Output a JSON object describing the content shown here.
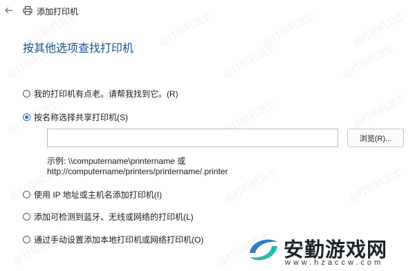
{
  "window": {
    "title": "添加打印机",
    "back_icon": "arrow-left-icon",
    "title_icon": "printer-icon"
  },
  "heading": "按其他选项查找打印机",
  "options": [
    {
      "label": "我的打印机有点老。请帮我找到它。(R)",
      "selected": false
    },
    {
      "label": "按名称选择共享打印机(S)",
      "selected": true
    },
    {
      "label": "使用 IP 地址或主机名添加打印机(I)",
      "selected": false
    },
    {
      "label": "添加可检测到蓝牙、无线或网络的打印机(L)",
      "selected": false
    },
    {
      "label": "通过手动设置添加本地打印机或网络打印机(O)",
      "selected": false
    }
  ],
  "share_input": {
    "value": "",
    "placeholder": ""
  },
  "browse_button": "浏览(R)...",
  "example": {
    "line1": "示例: \\\\computername\\printername 或",
    "line2": "http://computername/printers/printername/.printer"
  },
  "watermark_text": "@打印机卫士",
  "brand": {
    "name": "安勤游戏网",
    "url": "www.hzaccw.com"
  },
  "colors": {
    "accent": "#2b6cb8",
    "heading": "#1b4f8f",
    "brand_blue": "#2f7ec6",
    "brand_teal": "#27b9a6"
  }
}
